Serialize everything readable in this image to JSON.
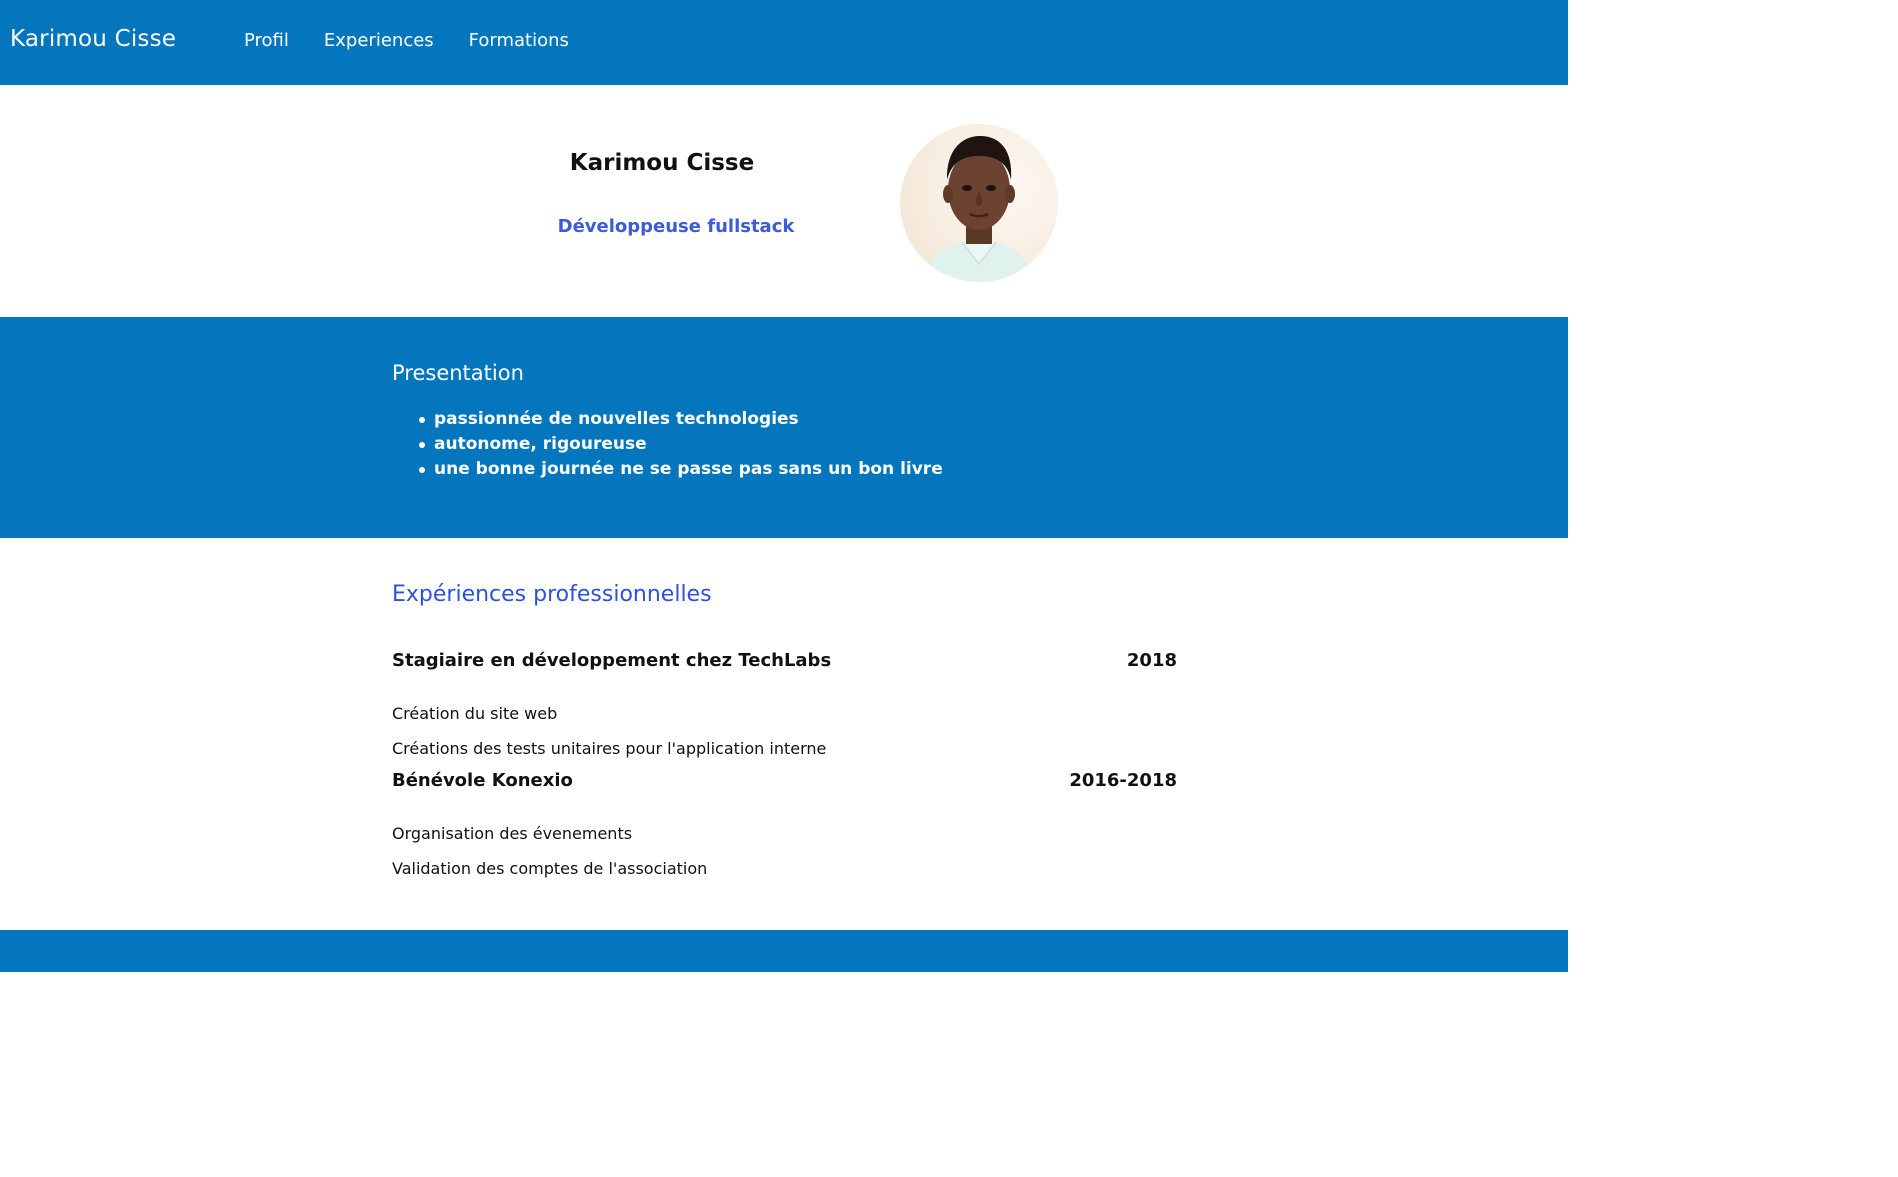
{
  "nav": {
    "brand": "Karimou Cisse",
    "links": [
      {
        "label": "Profil"
      },
      {
        "label": "Experiences"
      },
      {
        "label": "Formations"
      }
    ]
  },
  "hero": {
    "name": "Karimou Cisse",
    "role": "Développeuse fullstack"
  },
  "presentation": {
    "title": "Presentation",
    "items": [
      "passionnée de nouvelles technologies",
      "autonome, rigoureuse",
      "une bonne journée ne se passe pas sans un bon livre"
    ]
  },
  "experiences": {
    "title": "Expériences professionnelles",
    "items": [
      {
        "role": "Stagiaire en développement chez TechLabs",
        "date": "2018",
        "tasks": [
          "Création du site web",
          "Créations des tests unitaires pour l'application interne"
        ]
      },
      {
        "role": "Bénévole Konexio",
        "date": "2016-2018",
        "tasks": [
          "Organisation des évenements",
          "Validation des comptes de l'association"
        ]
      }
    ]
  },
  "colors": {
    "primary_blue": "#0476BE",
    "accent_blue": "#2E4FE0"
  }
}
